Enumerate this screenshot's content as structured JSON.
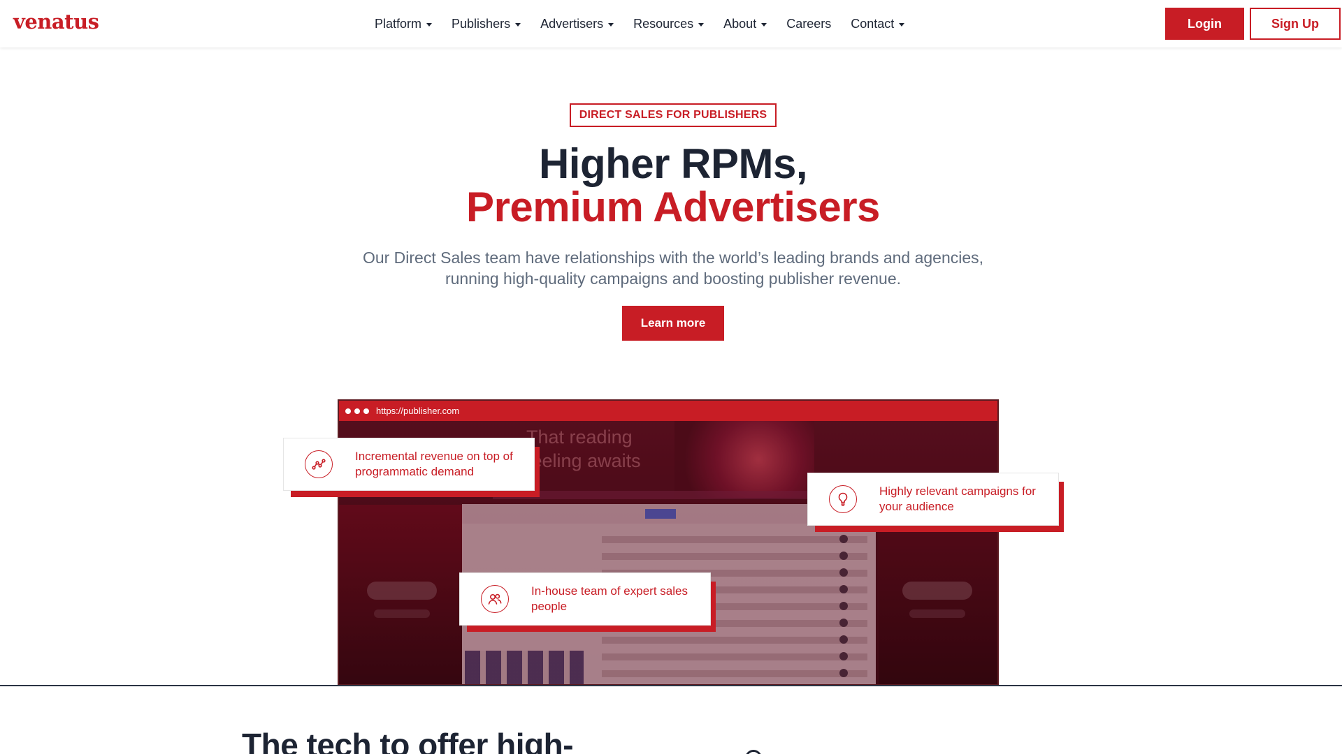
{
  "brand": {
    "logo": "venatus",
    "accent": "#c81d25",
    "dark": "#1d2433"
  },
  "nav": {
    "items": [
      {
        "label": "Platform",
        "dropdown": true
      },
      {
        "label": "Publishers",
        "dropdown": true
      },
      {
        "label": "Advertisers",
        "dropdown": true
      },
      {
        "label": "Resources",
        "dropdown": true
      },
      {
        "label": "About",
        "dropdown": true
      },
      {
        "label": "Careers",
        "dropdown": false
      },
      {
        "label": "Contact",
        "dropdown": true
      }
    ],
    "login": "Login",
    "signup": "Sign Up"
  },
  "hero": {
    "eyebrow": "DIRECT SALES FOR PUBLISHERS",
    "title_line1": "Higher RPMs,",
    "title_line2": "Premium Advertisers",
    "subtitle_line1": "Our Direct Sales team have relationships with the world’s leading brands and agencies,",
    "subtitle_line2": "running high-quality campaigns and boosting publisher revenue.",
    "cta": "Learn more"
  },
  "mockup": {
    "url": "https://publisher.com",
    "ghost_title_line1": "That reading",
    "ghost_title_line2": "feeling awaits"
  },
  "features": [
    {
      "text_line1": "Incremental revenue on top of",
      "text_line2": "programmatic demand",
      "icon": "chart-line-icon"
    },
    {
      "text_line1": "Highly relevant campaigns for",
      "text_line2": "your audience",
      "icon": "lightbulb-icon"
    },
    {
      "text_line1": "In-house team of expert sales",
      "text_line2": "people",
      "icon": "users-icon"
    }
  ],
  "next_section": {
    "title": "The tech to offer high-"
  }
}
